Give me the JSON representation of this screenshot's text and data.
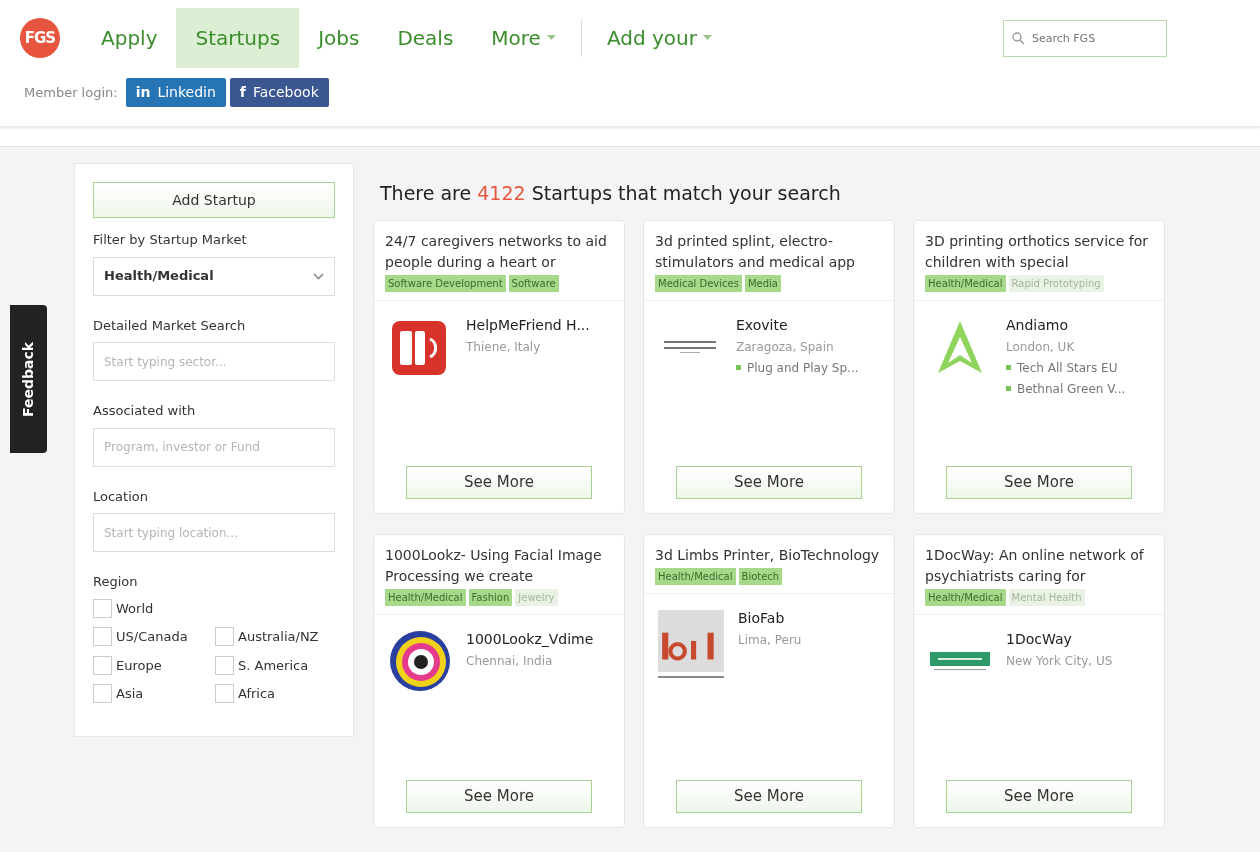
{
  "header": {
    "logo": "FGS",
    "nav": [
      {
        "label": "Apply",
        "selected": false,
        "dropdown": false
      },
      {
        "label": "Startups",
        "selected": true,
        "dropdown": false
      },
      {
        "label": "Jobs",
        "selected": false,
        "dropdown": false
      },
      {
        "label": "Deals",
        "selected": false,
        "dropdown": false
      },
      {
        "label": "More",
        "selected": false,
        "dropdown": true
      },
      {
        "label": "Add your",
        "selected": false,
        "dropdown": true
      }
    ],
    "search": {
      "placeholder": "Search FGS"
    },
    "login_label": "Member login:",
    "login_buttons": [
      {
        "kind": "linkedin",
        "icon": "in",
        "label": "Linkedin"
      },
      {
        "kind": "facebook",
        "icon": "f",
        "label": "Facebook"
      }
    ]
  },
  "feedback_tab": "Feedback",
  "sidebar": {
    "add_button": "Add Startup",
    "market_label": "Filter by Startup Market",
    "market_value": "Health/Medical",
    "fields": [
      {
        "label": "Detailed Market Search",
        "placeholder": "Start typing sector..."
      },
      {
        "label": "Associated with",
        "placeholder": "Program, investor or Fund"
      },
      {
        "label": "Location",
        "placeholder": "Start typing location..."
      }
    ],
    "region_label": "Region",
    "regions": [
      {
        "label": "World",
        "checked": false
      },
      {
        "label": "US/Canada",
        "checked": false
      },
      {
        "label": "Australia/NZ",
        "checked": false
      },
      {
        "label": "Europe",
        "checked": false
      },
      {
        "label": "S. America",
        "checked": false
      },
      {
        "label": "Asia",
        "checked": false
      },
      {
        "label": "Africa",
        "checked": false
      }
    ]
  },
  "results": {
    "prefix": "There are",
    "count": "4122",
    "suffix": "Startups that match your search"
  },
  "cards": [
    {
      "title": "24/7 caregivers networks to aid people during a heart or",
      "tags": [
        {
          "label": "Software Development",
          "highlighted": true
        },
        {
          "label": "Software",
          "highlighted": true
        }
      ],
      "kind": "helpme",
      "name": "HelpMeFriend H...",
      "location": "Thiene, Italy",
      "button": "See More"
    },
    {
      "title": "3d printed splint, electro-stimulators and medical app",
      "tags": [
        {
          "label": "Medical Devices",
          "highlighted": true
        },
        {
          "label": "Media",
          "highlighted": true
        }
      ],
      "kind": "exovite",
      "name": "Exovite",
      "location": "Zaragoza, Spain",
      "programs": [
        "Plug and Play Sp..."
      ],
      "button": "See More"
    },
    {
      "title": "3D printing orthotics service for children with special",
      "tags": [
        {
          "label": "Health/Medical",
          "highlighted": true
        },
        {
          "label": "Rapid Prototyping",
          "highlighted": false
        }
      ],
      "kind": "andiamo",
      "name": "Andiamo",
      "location": "London, UK",
      "programs": [
        "Tech All Stars EU",
        "Bethnal Green V..."
      ],
      "button": "See More"
    },
    {
      "title": "1000Lookz- Using Facial Image Processing we create",
      "tags": [
        {
          "label": "Health/Medical",
          "highlighted": true
        },
        {
          "label": "Fashion",
          "highlighted": true
        },
        {
          "label": "Jewelry",
          "highlighted": false
        }
      ],
      "kind": "eye",
      "name": "1000Lookz_Vdime",
      "location": "Chennai, India",
      "button": "See More"
    },
    {
      "title": "3d Limbs Printer, BioTechnology",
      "tags": [
        {
          "label": "Health/Medical",
          "highlighted": true
        },
        {
          "label": "Biotech",
          "highlighted": true
        }
      ],
      "kind": "biofab",
      "name": "BioFab",
      "location": "Lima, Peru",
      "button": "See More"
    },
    {
      "title": "1DocWay: An online network of psychiatrists caring for",
      "tags": [
        {
          "label": "Health/Medical",
          "highlighted": true
        },
        {
          "label": "Mental Health",
          "highlighted": false
        }
      ],
      "kind": "docway",
      "name": "1DocWay",
      "location": "New York City, US",
      "button": "See More"
    }
  ]
}
